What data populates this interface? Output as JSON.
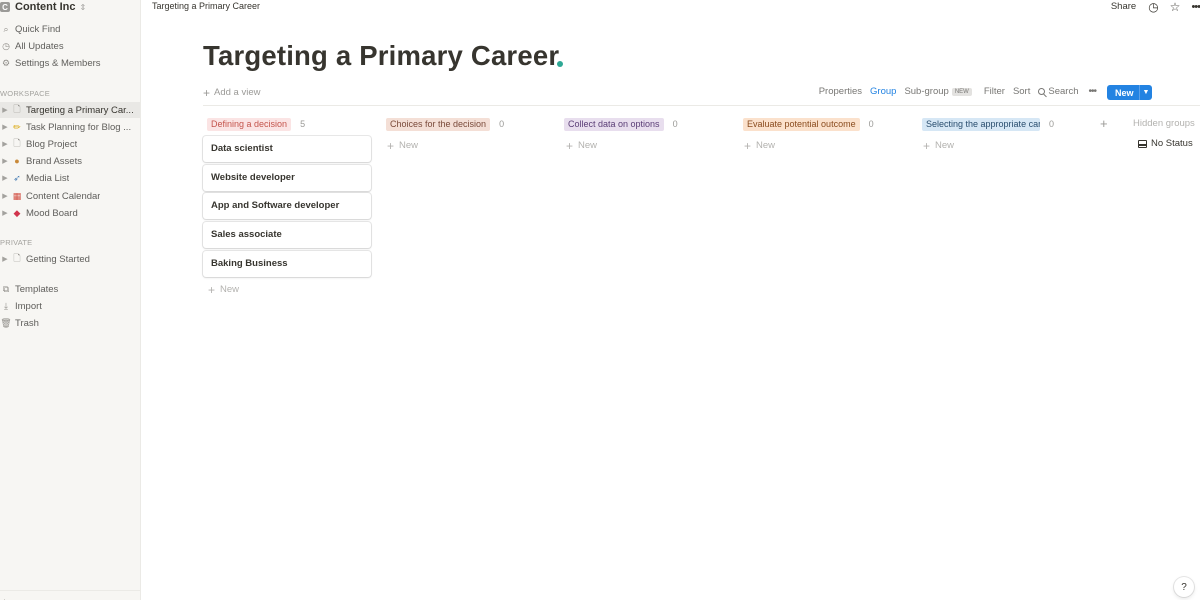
{
  "sidebar": {
    "workspace_name": "Content Inc",
    "workspace_avatar": "C",
    "top_items": [
      {
        "label": "Quick Find",
        "icon": "search-icon"
      },
      {
        "label": "All Updates",
        "icon": "clock-icon"
      },
      {
        "label": "Settings & Members",
        "icon": "gear-icon"
      }
    ],
    "workspace_section_label": "WORKSPACE",
    "workspace_pages": [
      {
        "label": "Targeting a Primary Car...",
        "icon": "page-icon",
        "active": true
      },
      {
        "label": "Task Planning for Blog ...",
        "icon": "pencil-emoji-icon"
      },
      {
        "label": "Blog Project",
        "icon": "page-icon"
      },
      {
        "label": "Brand Assets",
        "icon": "palette-emoji-icon"
      },
      {
        "label": "Media List",
        "icon": "syringe-emoji-icon"
      },
      {
        "label": "Content Calendar",
        "icon": "calendar-emoji-icon"
      },
      {
        "label": "Mood Board",
        "icon": "gem-emoji-icon"
      }
    ],
    "private_section_label": "PRIVATE",
    "private_pages": [
      {
        "label": "Getting Started",
        "icon": "page-icon"
      }
    ],
    "bottom_items": [
      {
        "label": "Templates",
        "icon": "templates-icon"
      },
      {
        "label": "Import",
        "icon": "import-icon"
      },
      {
        "label": "Trash",
        "icon": "trash-icon"
      }
    ]
  },
  "topbar": {
    "breadcrumb": "Targeting a Primary Career",
    "share_label": "Share"
  },
  "page": {
    "title": "Targeting a Primary Career"
  },
  "view_bar": {
    "add_view_label": "Add a view",
    "options": {
      "properties": "Properties",
      "group": "Group",
      "subgroup": "Sub-group",
      "subgroup_badge": "NEW",
      "filter": "Filter",
      "sort": "Sort",
      "search": "Search"
    },
    "new_button_label": "New"
  },
  "board": {
    "columns": [
      {
        "name": "Defining a decision",
        "count": "5",
        "color": "#fbe4e4",
        "cards": [
          "Data scientist",
          "Website developer",
          "App and Software developer",
          "Sales associate",
          "Baking Business"
        ]
      },
      {
        "name": "Choices for the decision",
        "count": "0",
        "color": "#f4dfd6",
        "cards": []
      },
      {
        "name": "Collect data on options",
        "count": "0",
        "color": "#e8deee",
        "cards": []
      },
      {
        "name": "Evaluate potential outcome",
        "count": "0",
        "color": "#fbe1cc",
        "cards": []
      },
      {
        "name": "Selecting the appropriate car",
        "count": "0",
        "color": "#d6e7f5",
        "cards": []
      }
    ],
    "new_label": "New",
    "hidden_groups_label": "Hidden groups",
    "hidden_group_item": "No Status"
  },
  "help_label": "?"
}
